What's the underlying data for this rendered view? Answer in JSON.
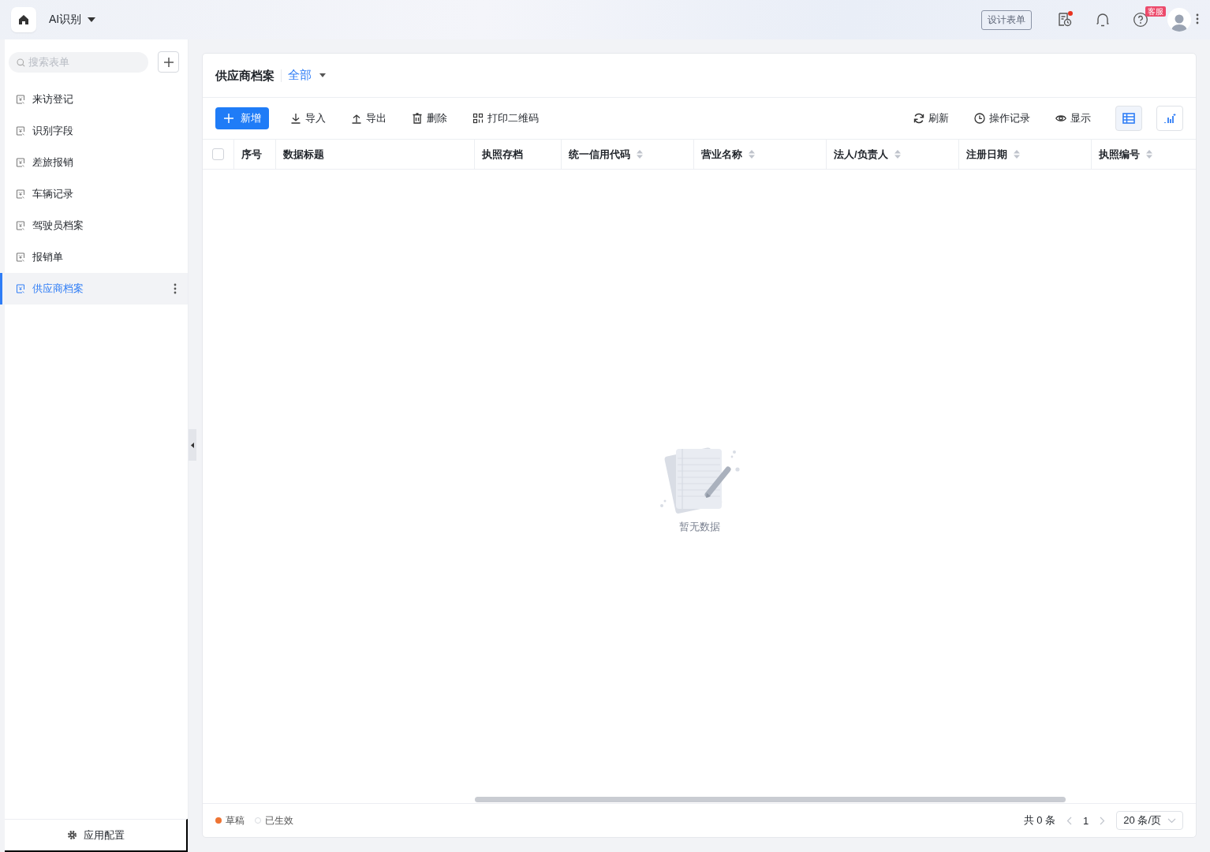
{
  "topbar": {
    "app_name": "AI识别",
    "design_button": "设计表单",
    "actions": [
      {
        "kind": "schedule",
        "dot": true
      },
      {
        "kind": "bell"
      },
      {
        "kind": "help",
        "badge": "客服"
      }
    ]
  },
  "sidebar": {
    "search": {
      "placeholder": "搜索表单"
    },
    "items": [
      {
        "label": "来访登记",
        "selected": false
      },
      {
        "label": "识别字段",
        "selected": false
      },
      {
        "label": "差旅报销",
        "selected": false
      },
      {
        "label": "车辆记录",
        "selected": false
      },
      {
        "label": "驾驶员档案",
        "selected": false
      },
      {
        "label": "报销单",
        "selected": false
      },
      {
        "label": "供应商档案",
        "selected": true
      }
    ],
    "footer": "应用配置"
  },
  "panel": {
    "title": "供应商档案",
    "filter": "全部",
    "toolbar_left": [
      {
        "kind": "add",
        "label": "新增"
      },
      {
        "kind": "import",
        "label": "导入"
      },
      {
        "kind": "export",
        "label": "导出"
      },
      {
        "kind": "delete",
        "label": "删除"
      },
      {
        "kind": "qrcode",
        "label": "打印二维码"
      }
    ],
    "toolbar_right": [
      {
        "kind": "refresh",
        "label": "刷新"
      },
      {
        "kind": "history",
        "label": "操作记录"
      },
      {
        "kind": "eye",
        "label": "显示"
      }
    ],
    "views": [
      {
        "kind": "table",
        "selected": true
      },
      {
        "kind": "chart",
        "selected": false
      }
    ],
    "table": {
      "select_all_checked": false,
      "columns": [
        {
          "label": "序号",
          "sortable": false
        },
        {
          "label": "数据标题",
          "sortable": false
        },
        {
          "label": "执照存档",
          "sortable": false
        },
        {
          "label": "统一信用代码",
          "sortable": true
        },
        {
          "label": "营业名称",
          "sortable": true
        },
        {
          "label": "法人/负责人",
          "sortable": true
        },
        {
          "label": "注册日期",
          "sortable": true
        },
        {
          "label": "执照编号",
          "sortable": true
        }
      ],
      "empty_text": "暂无数据"
    },
    "legend": [
      {
        "label": "草稿",
        "selected": true,
        "color": "#ee7433"
      },
      {
        "label": "已生效",
        "selected": false
      }
    ],
    "pagination": {
      "total": "共 0 条",
      "page": "1",
      "page_size": "20 条/页"
    }
  }
}
